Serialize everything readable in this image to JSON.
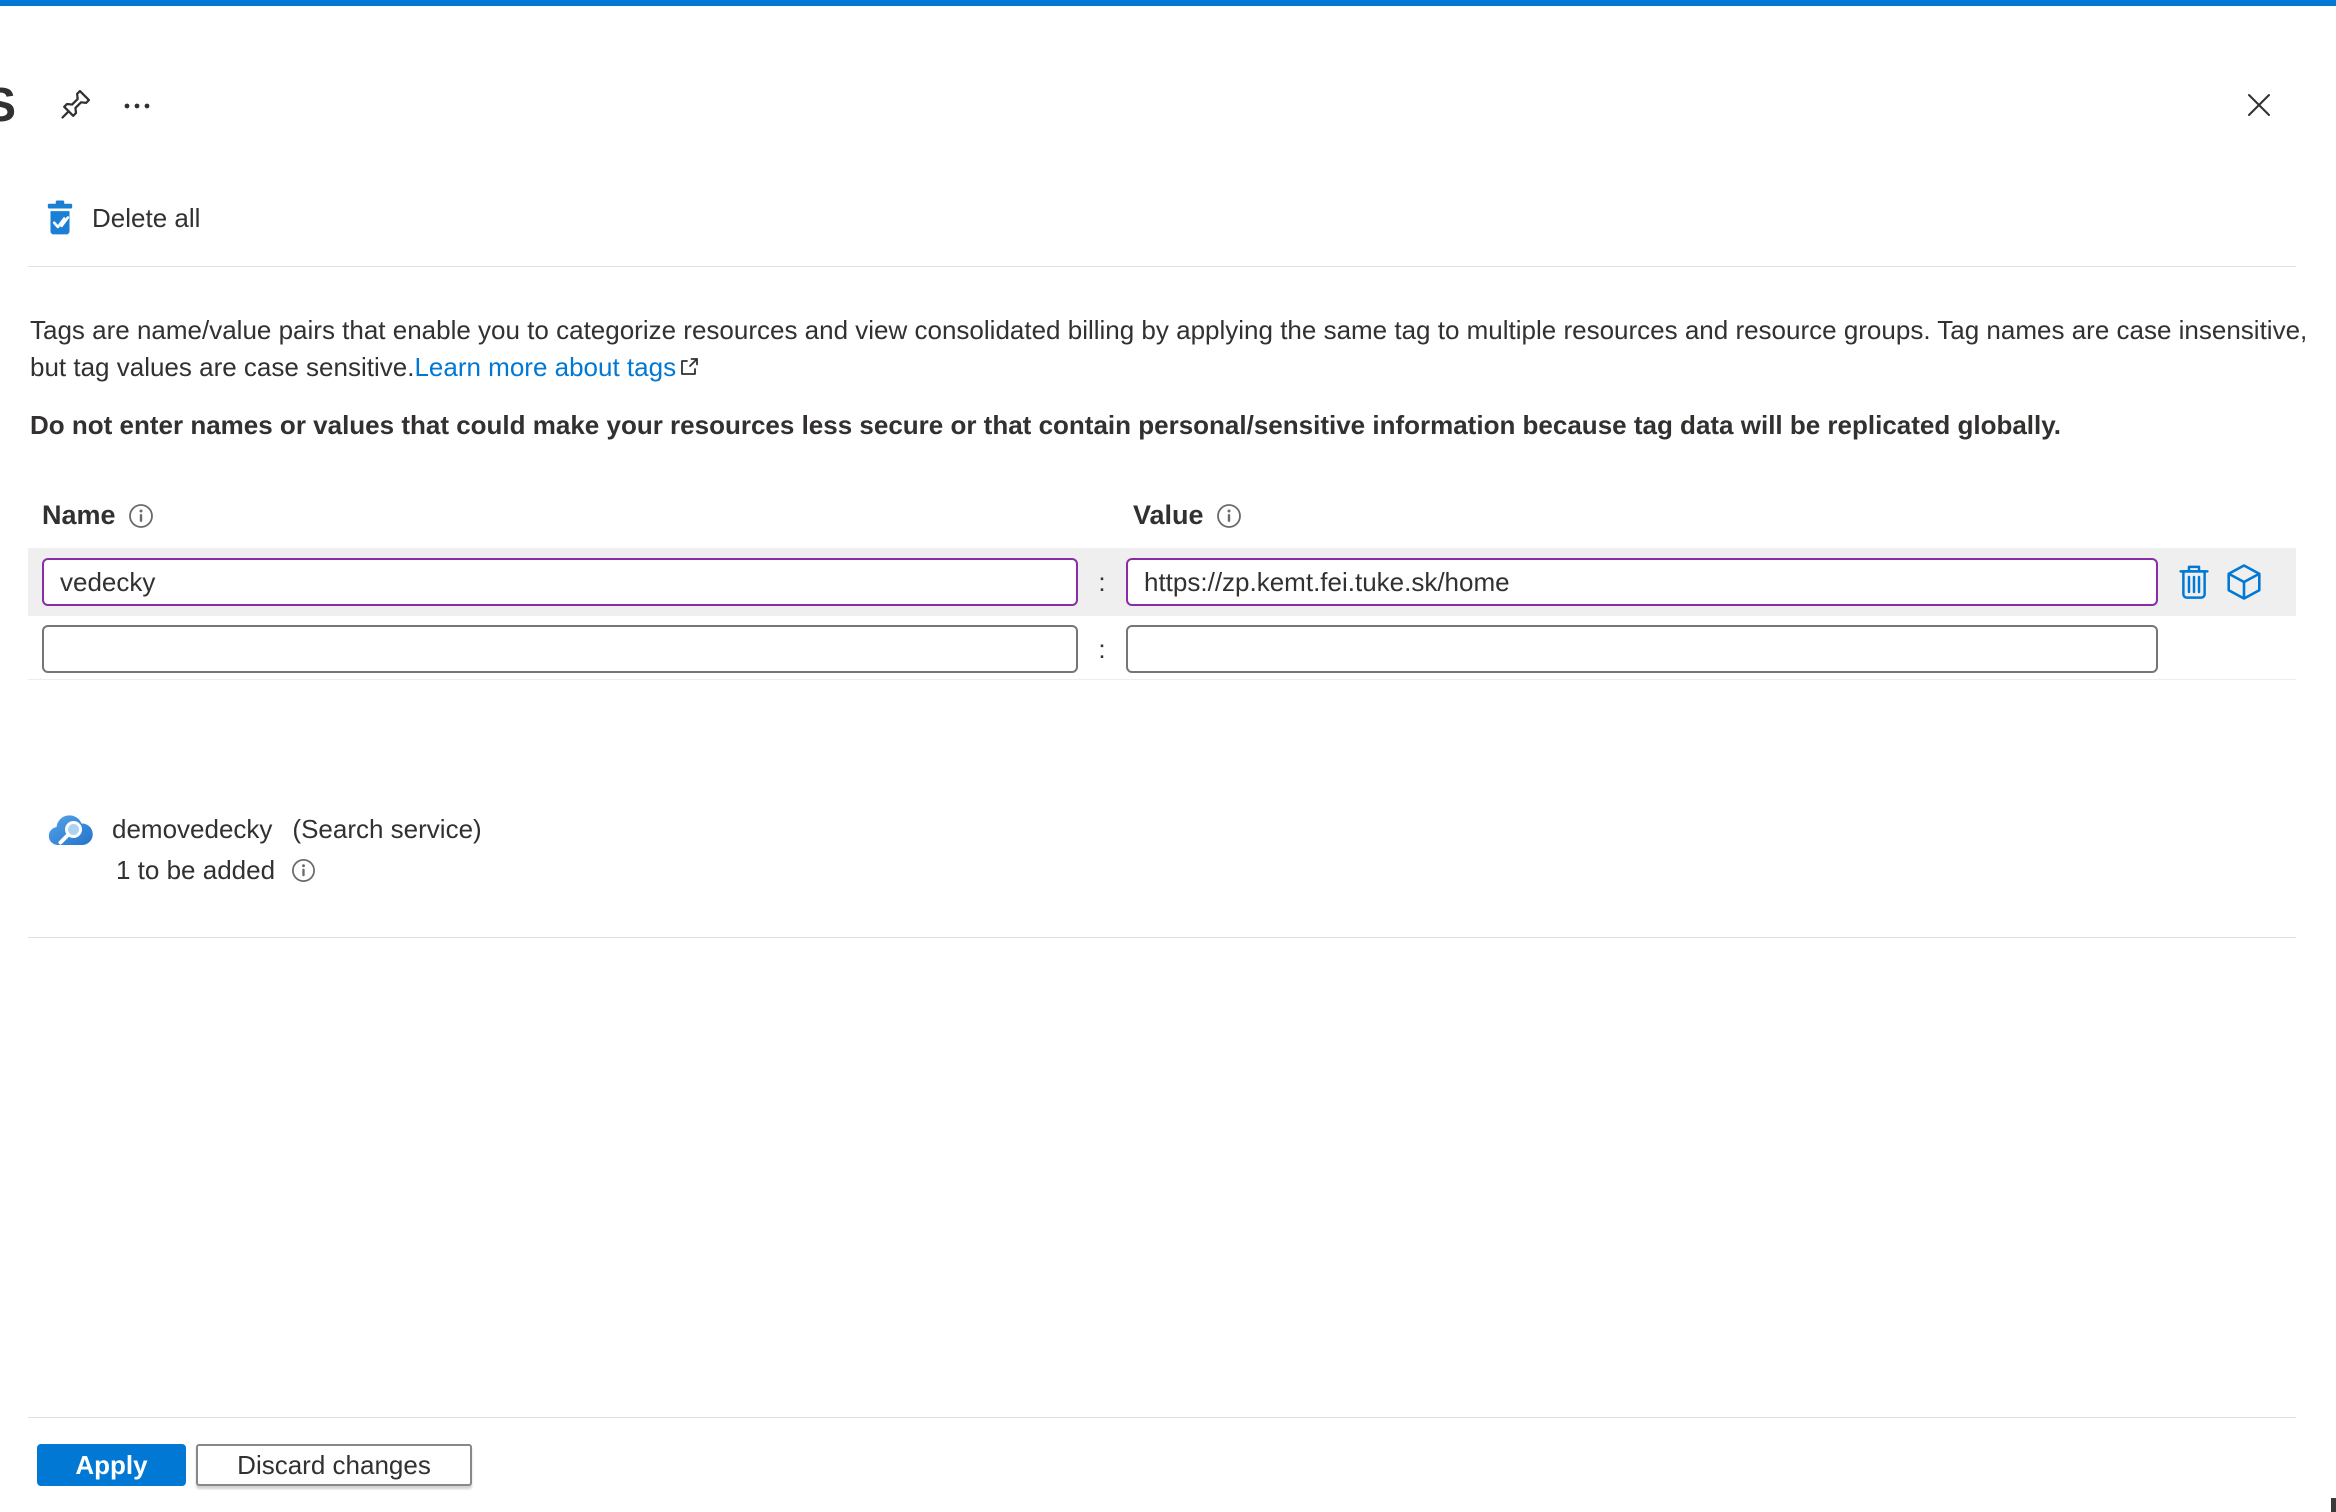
{
  "page": {
    "title_partial": "S"
  },
  "toolbar": {
    "delete_all_label": "Delete all"
  },
  "description": {
    "text": "Tags are name/value pairs that enable you to categorize resources and view consolidated billing by applying the same tag to multiple resources and resource groups. Tag names are case insensitive, but tag values are case sensitive.",
    "link_label": "Learn more about tags",
    "warning": "Do not enter names or values that could make your resources less secure or that contain personal/sensitive information because tag data will be replicated globally."
  },
  "tag_editor": {
    "name_header": "Name",
    "value_header": "Value",
    "separator": ":",
    "rows": [
      {
        "name": "vedecky",
        "value": "https://zp.kemt.fei.tuke.sk/home"
      },
      {
        "name": "",
        "value": ""
      }
    ]
  },
  "resource": {
    "name": "demovedecky",
    "type": "(Search service)",
    "status": "1 to be added"
  },
  "footer": {
    "apply_label": "Apply",
    "discard_label": "Discard changes"
  },
  "colors": {
    "accent": "#0078d4",
    "modified_border": "#8a2da5",
    "row_background": "#efefef",
    "link": "#0078d4"
  }
}
